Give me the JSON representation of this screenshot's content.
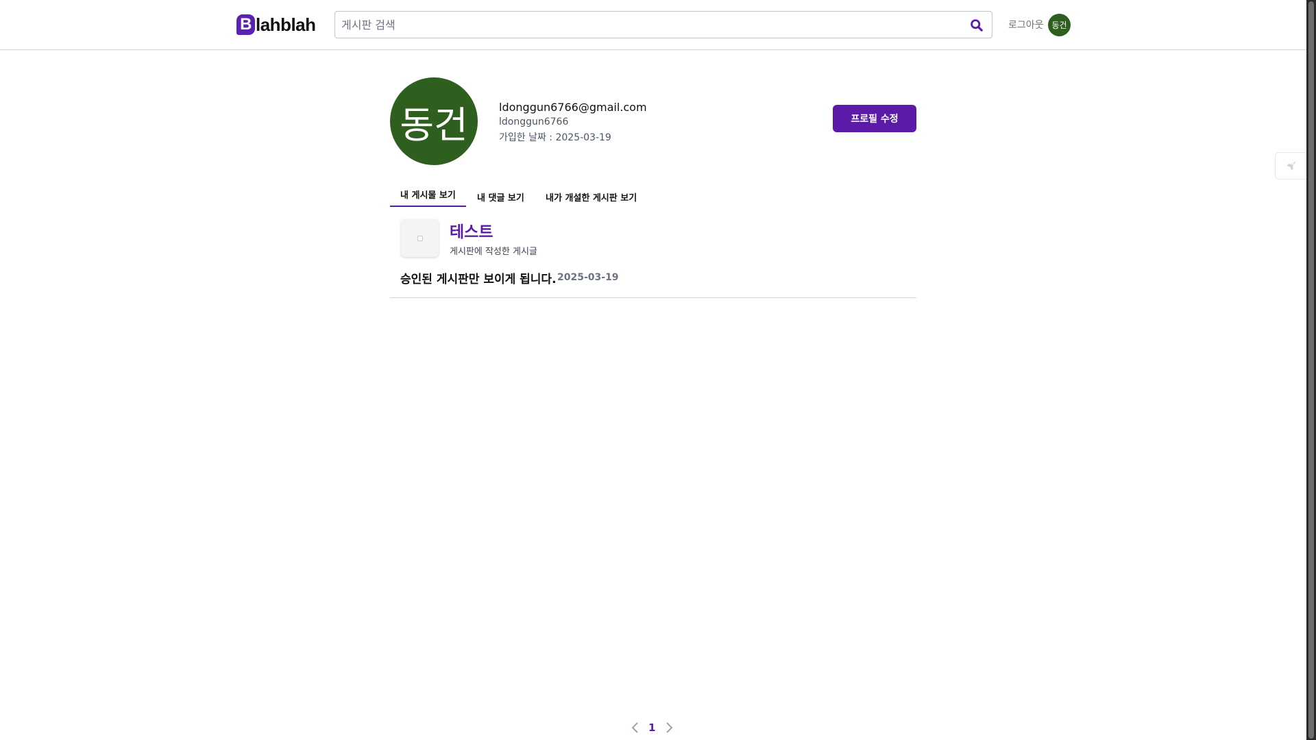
{
  "header": {
    "logo_letter": "B",
    "logo_rest": "lahblah",
    "search_placeholder": "게시판 검색",
    "logout_label": "로그아웃",
    "avatar_text": "동건"
  },
  "profile": {
    "avatar_text": "동건",
    "email": "ldonggun6766@gmail.com",
    "username": "ldonggun6766",
    "joined": "가입한 날짜 : 2025-03-19",
    "edit_label": "프로필 수정"
  },
  "tabs": [
    {
      "label": "내 게시물 보기",
      "active": true
    },
    {
      "label": "내 댓글 보기",
      "active": false
    },
    {
      "label": "내가 개설한 게시판 보기",
      "active": false
    }
  ],
  "posts": [
    {
      "board_name": "테스트",
      "board_sub": "게시판에 작성한 게시글",
      "title": "승인된 게시판만 보이게 됩니다.",
      "date": "2025-03-19"
    }
  ],
  "pagination": {
    "current": "1"
  },
  "colors": {
    "accent": "#5b1aa8",
    "avatar_bg": "#2f5f1f"
  },
  "icons": {
    "search": "search-icon",
    "float": "rocket-icon",
    "prev": "chevron-left-icon",
    "next": "chevron-right-icon"
  }
}
